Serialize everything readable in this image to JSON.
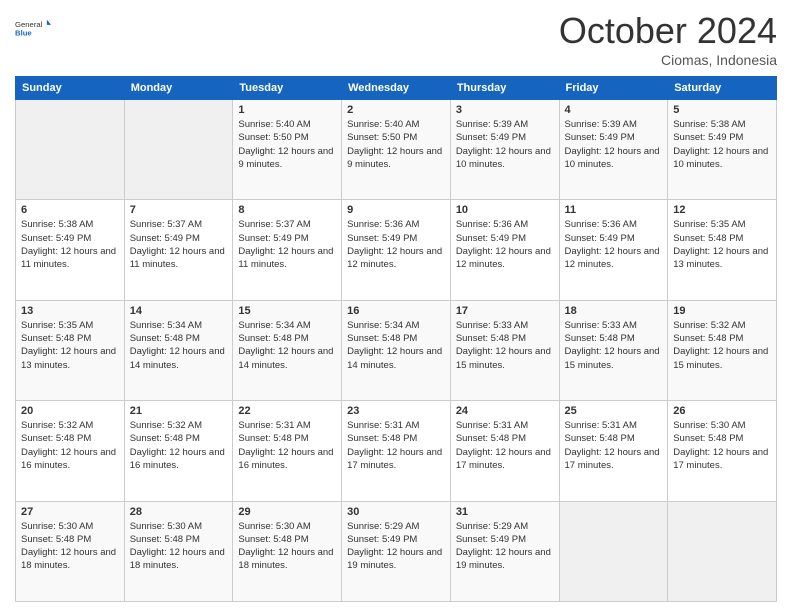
{
  "logo": {
    "general": "General",
    "blue": "Blue"
  },
  "title": "October 2024",
  "location": "Ciomas, Indonesia",
  "days_of_week": [
    "Sunday",
    "Monday",
    "Tuesday",
    "Wednesday",
    "Thursday",
    "Friday",
    "Saturday"
  ],
  "weeks": [
    [
      {
        "day": "",
        "empty": true
      },
      {
        "day": "",
        "empty": true
      },
      {
        "day": "1",
        "sunrise": "5:40 AM",
        "sunset": "5:50 PM",
        "daylight": "12 hours and 9 minutes."
      },
      {
        "day": "2",
        "sunrise": "5:40 AM",
        "sunset": "5:50 PM",
        "daylight": "12 hours and 9 minutes."
      },
      {
        "day": "3",
        "sunrise": "5:39 AM",
        "sunset": "5:49 PM",
        "daylight": "12 hours and 10 minutes."
      },
      {
        "day": "4",
        "sunrise": "5:39 AM",
        "sunset": "5:49 PM",
        "daylight": "12 hours and 10 minutes."
      },
      {
        "day": "5",
        "sunrise": "5:38 AM",
        "sunset": "5:49 PM",
        "daylight": "12 hours and 10 minutes."
      }
    ],
    [
      {
        "day": "6",
        "sunrise": "5:38 AM",
        "sunset": "5:49 PM",
        "daylight": "12 hours and 11 minutes."
      },
      {
        "day": "7",
        "sunrise": "5:37 AM",
        "sunset": "5:49 PM",
        "daylight": "12 hours and 11 minutes."
      },
      {
        "day": "8",
        "sunrise": "5:37 AM",
        "sunset": "5:49 PM",
        "daylight": "12 hours and 11 minutes."
      },
      {
        "day": "9",
        "sunrise": "5:36 AM",
        "sunset": "5:49 PM",
        "daylight": "12 hours and 12 minutes."
      },
      {
        "day": "10",
        "sunrise": "5:36 AM",
        "sunset": "5:49 PM",
        "daylight": "12 hours and 12 minutes."
      },
      {
        "day": "11",
        "sunrise": "5:36 AM",
        "sunset": "5:49 PM",
        "daylight": "12 hours and 12 minutes."
      },
      {
        "day": "12",
        "sunrise": "5:35 AM",
        "sunset": "5:48 PM",
        "daylight": "12 hours and 13 minutes."
      }
    ],
    [
      {
        "day": "13",
        "sunrise": "5:35 AM",
        "sunset": "5:48 PM",
        "daylight": "12 hours and 13 minutes."
      },
      {
        "day": "14",
        "sunrise": "5:34 AM",
        "sunset": "5:48 PM",
        "daylight": "12 hours and 14 minutes."
      },
      {
        "day": "15",
        "sunrise": "5:34 AM",
        "sunset": "5:48 PM",
        "daylight": "12 hours and 14 minutes."
      },
      {
        "day": "16",
        "sunrise": "5:34 AM",
        "sunset": "5:48 PM",
        "daylight": "12 hours and 14 minutes."
      },
      {
        "day": "17",
        "sunrise": "5:33 AM",
        "sunset": "5:48 PM",
        "daylight": "12 hours and 15 minutes."
      },
      {
        "day": "18",
        "sunrise": "5:33 AM",
        "sunset": "5:48 PM",
        "daylight": "12 hours and 15 minutes."
      },
      {
        "day": "19",
        "sunrise": "5:32 AM",
        "sunset": "5:48 PM",
        "daylight": "12 hours and 15 minutes."
      }
    ],
    [
      {
        "day": "20",
        "sunrise": "5:32 AM",
        "sunset": "5:48 PM",
        "daylight": "12 hours and 16 minutes."
      },
      {
        "day": "21",
        "sunrise": "5:32 AM",
        "sunset": "5:48 PM",
        "daylight": "12 hours and 16 minutes."
      },
      {
        "day": "22",
        "sunrise": "5:31 AM",
        "sunset": "5:48 PM",
        "daylight": "12 hours and 16 minutes."
      },
      {
        "day": "23",
        "sunrise": "5:31 AM",
        "sunset": "5:48 PM",
        "daylight": "12 hours and 17 minutes."
      },
      {
        "day": "24",
        "sunrise": "5:31 AM",
        "sunset": "5:48 PM",
        "daylight": "12 hours and 17 minutes."
      },
      {
        "day": "25",
        "sunrise": "5:31 AM",
        "sunset": "5:48 PM",
        "daylight": "12 hours and 17 minutes."
      },
      {
        "day": "26",
        "sunrise": "5:30 AM",
        "sunset": "5:48 PM",
        "daylight": "12 hours and 17 minutes."
      }
    ],
    [
      {
        "day": "27",
        "sunrise": "5:30 AM",
        "sunset": "5:48 PM",
        "daylight": "12 hours and 18 minutes."
      },
      {
        "day": "28",
        "sunrise": "5:30 AM",
        "sunset": "5:48 PM",
        "daylight": "12 hours and 18 minutes."
      },
      {
        "day": "29",
        "sunrise": "5:30 AM",
        "sunset": "5:48 PM",
        "daylight": "12 hours and 18 minutes."
      },
      {
        "day": "30",
        "sunrise": "5:29 AM",
        "sunset": "5:49 PM",
        "daylight": "12 hours and 19 minutes."
      },
      {
        "day": "31",
        "sunrise": "5:29 AM",
        "sunset": "5:49 PM",
        "daylight": "12 hours and 19 minutes."
      },
      {
        "day": "",
        "empty": true
      },
      {
        "day": "",
        "empty": true
      }
    ]
  ],
  "labels": {
    "sunrise": "Sunrise:",
    "sunset": "Sunset:",
    "daylight": "Daylight:"
  }
}
